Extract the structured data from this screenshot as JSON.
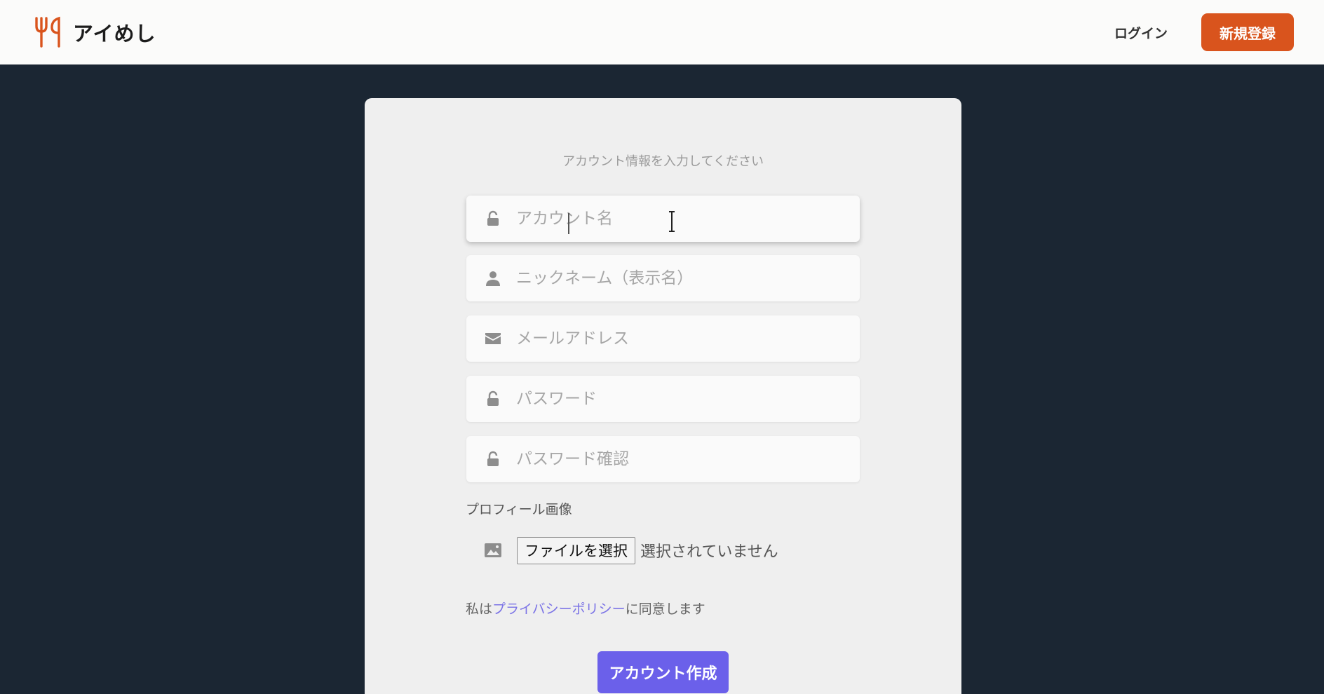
{
  "header": {
    "app_name": "アイめし",
    "login_label": "ログイン",
    "signup_label": "新規登録",
    "accent_color": "#d9541d"
  },
  "form": {
    "subtitle": "アカウント情報を入力してください",
    "fields": [
      {
        "icon": "lock-icon",
        "placeholder": "アカウント名",
        "value": ""
      },
      {
        "icon": "user-icon",
        "placeholder": "ニックネーム（表示名）",
        "value": ""
      },
      {
        "icon": "envelope-icon",
        "placeholder": "メールアドレス",
        "value": ""
      },
      {
        "icon": "lock-icon",
        "placeholder": "パスワード",
        "value": ""
      },
      {
        "icon": "lock-icon",
        "placeholder": "パスワード確認",
        "value": ""
      }
    ],
    "profile_label": "プロフィール画像",
    "file_button_label": "ファイルを選択",
    "file_status": "選択されていません",
    "agree_prefix": "私は",
    "agree_link": "プライバシーポリシー",
    "agree_suffix": "に同意します",
    "submit_label": "アカウント作成",
    "submit_color": "#6b60ea"
  }
}
